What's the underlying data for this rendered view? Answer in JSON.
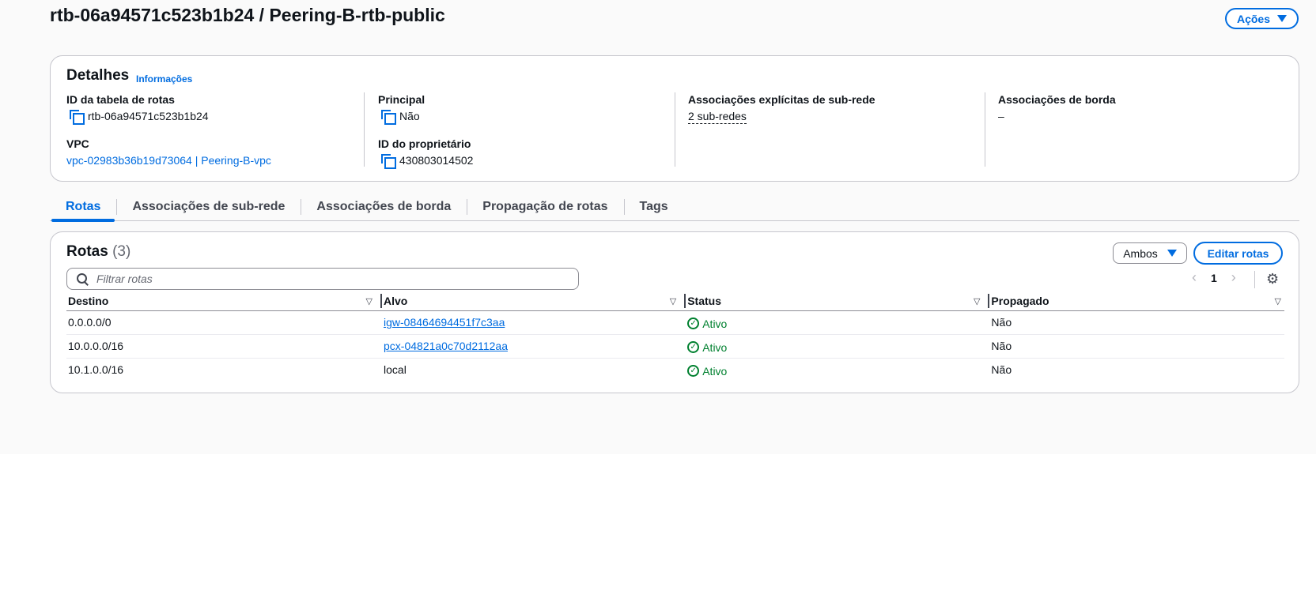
{
  "header": {
    "title": "rtb-06a94571c523b1b24 / Peering-B-rtb-public",
    "actions_label": "Ações"
  },
  "details": {
    "title": "Detalhes",
    "info_link": "Informações",
    "route_table_id_label": "ID da tabela de rotas",
    "route_table_id": "rtb-06a94571c523b1b24",
    "vpc_label": "VPC",
    "vpc_value": "vpc-02983b36b19d73064 | Peering-B-vpc",
    "main_label": "Principal",
    "main_value": "Não",
    "owner_label": "ID do proprietário",
    "owner_value": "430803014502",
    "explicit_label": "Associações explícitas de sub-rede",
    "explicit_value": "2 sub-redes",
    "edge_label": "Associações de borda",
    "edge_value": "–"
  },
  "tabs": [
    {
      "label": "Rotas",
      "active": true
    },
    {
      "label": "Associações de sub-rede"
    },
    {
      "label": "Associações de borda"
    },
    {
      "label": "Propagação de rotas"
    },
    {
      "label": "Tags"
    }
  ],
  "routes": {
    "title": "Rotas",
    "count": "(3)",
    "filter_label": "Ambos",
    "edit_label": "Editar rotas",
    "search_placeholder": "Filtrar rotas",
    "page": "1",
    "columns": [
      "Destino",
      "Alvo",
      "Status",
      "Propagado"
    ],
    "rows": [
      {
        "destination": "0.0.0.0/0",
        "target": "igw-08464694451f7c3aa",
        "target_link": true,
        "status": "Ativo",
        "propagated": "Não"
      },
      {
        "destination": "10.0.0.0/16",
        "target": "pcx-04821a0c70d2112aa",
        "target_link": true,
        "status": "Ativo",
        "propagated": "Não"
      },
      {
        "destination": "10.1.0.0/16",
        "target": "local",
        "target_link": false,
        "status": "Ativo",
        "propagated": "Não"
      }
    ]
  },
  "colors": {
    "accent": "#006ce0",
    "success": "#00802f",
    "border": "#c6c6cd"
  }
}
